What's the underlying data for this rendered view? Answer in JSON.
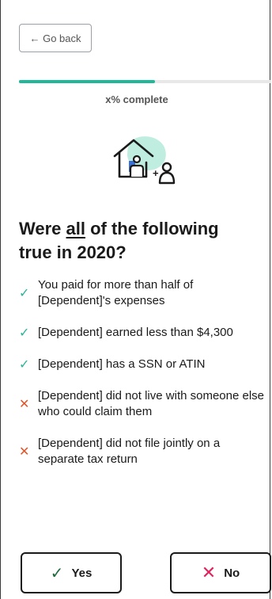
{
  "nav": {
    "back_label": "← Go back"
  },
  "progress": {
    "value_fraction": 0.54,
    "label": "x% complete",
    "fill_color": "#1fb89a"
  },
  "illustration": {
    "icon": "house-with-dependent-icon"
  },
  "question": {
    "pre": "Were ",
    "emphasis": "all",
    "post": " of the following true in 2020?"
  },
  "criteria": [
    {
      "status": "check",
      "text": "You paid for more than half of [Dependent]'s expenses"
    },
    {
      "status": "check",
      "text": "[Dependent] earned less than $4,300"
    },
    {
      "status": "check",
      "text": "[Dependent] has a SSN or ATIN"
    },
    {
      "status": "cross",
      "text": "[Dependent] did not live with someone else who could claim them"
    },
    {
      "status": "cross",
      "text": "[Dependent] did not file jointly on a separate tax return"
    }
  ],
  "answers": {
    "yes_label": "Yes",
    "no_label": "No"
  },
  "icons": {
    "check": "✓",
    "cross": "✕"
  },
  "colors": {
    "check": "#2bb59b",
    "cross": "#e0552a",
    "no_icon": "#e0245e",
    "yes_icon": "#1f6b3f"
  }
}
